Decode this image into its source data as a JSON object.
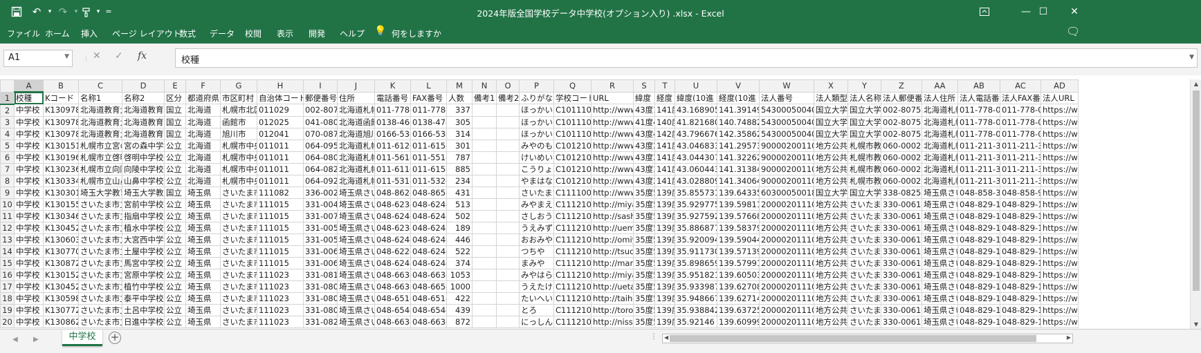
{
  "window": {
    "title": "2024年版全国学校データ中学校(オプション入り) .xlsx  -  Excel"
  },
  "quick_access": {
    "customize": "="
  },
  "ribbon": {
    "tabs": [
      "ファイル",
      "ホーム",
      "挿入",
      "ページ レイアウト",
      "数式",
      "データ",
      "校閲",
      "表示",
      "開発",
      "ヘルプ"
    ],
    "tell_me": "何をしますか"
  },
  "formula_bar": {
    "name_box": "A1",
    "cancel": "✕",
    "enter": "✓",
    "fx": "fx",
    "value": "校種"
  },
  "columns": [
    "A",
    "B",
    "C",
    "D",
    "E",
    "F",
    "G",
    "H",
    "I",
    "J",
    "K",
    "L",
    "M",
    "N",
    "O",
    "P",
    "Q",
    "R",
    "S",
    "T",
    "U",
    "V",
    "W",
    "X",
    "Y",
    "Z",
    "AA",
    "AB",
    "AC",
    "AD"
  ],
  "rows": [
    [
      "1",
      "校種",
      "Kコード",
      "名称1",
      "名称2",
      "区分",
      "都道府県",
      "市区町村",
      "自治体コード",
      "郵便番号",
      "住所",
      "電話番号",
      "FAX番号",
      "人数",
      "備考1",
      "備考2",
      "ふりがな",
      "学校コード",
      "URL",
      "緯度",
      "経度",
      "緯度(10進",
      "経度(10進",
      "法人番号",
      "法人類型",
      "法人名称",
      "法人郵便番",
      "法人住所",
      "法人電話番",
      "法人FAX番",
      "法人URL"
    ],
    [
      "2",
      "中学校",
      "K1309786",
      "北海道教育大",
      "北海道教育大",
      "国立",
      "北海道",
      "札幌市北区",
      "011029",
      "002-8075",
      "北海道札幌",
      "011-778-0",
      "011-778-0",
      "337",
      "",
      "",
      "ほっかいど",
      "C1011100",
      "http://www",
      "43度1",
      "141度",
      "43.16890597",
      "141.3914963",
      "5430005004015",
      "国立大学",
      "国立大学",
      "002-8075",
      "北海道札幌",
      "011-778-0",
      "011-778-06",
      "https://www"
    ],
    [
      "3",
      "中学校",
      "K1309784",
      "北海道教育大",
      "北海道教育大",
      "国立",
      "北海道",
      "函館市",
      "012025",
      "041-0806",
      "北海道函館",
      "0138-46-2",
      "0138-47-0",
      "305",
      "",
      "",
      "ほっかいど",
      "C1011100",
      "http://www",
      "41度4",
      "140度",
      "41.82168047",
      "140.7488202",
      "5430005004015",
      "国立大学",
      "国立大学",
      "002-8075",
      "北海道札幌",
      "011-778-0",
      "011-778-06",
      "https://www"
    ],
    [
      "4",
      "中学校",
      "K1309785",
      "北海道教育大",
      "北海道教育大",
      "国立",
      "北海道",
      "旭川市",
      "012041",
      "070-0874",
      "北海道旭川",
      "0166-53-2",
      "0166-53-2",
      "314",
      "",
      "",
      "ほっかいど",
      "C1011100",
      "http://www",
      "43度4",
      "142度",
      "43.7966765",
      "142.3586282",
      "5430005004015",
      "国立大学",
      "国立大学",
      "002-8075",
      "北海道札幌",
      "011-778-0",
      "011-778-06",
      "https://www"
    ],
    [
      "5",
      "中学校",
      "K1301519",
      "札幌市立宮の",
      "宮の森中学校",
      "公立",
      "北海道",
      "札幌市中央",
      "011011",
      "064-0951",
      "北海道札幌",
      "011-612-1",
      "011-615-6",
      "301",
      "",
      "",
      "みやのもり",
      "C1012101",
      "http://www",
      "43度2",
      "141度",
      "43.04683398",
      "141.2957348",
      "9000020011002",
      "地方公共",
      "札幌市教",
      "060-0002",
      "北海道札幌",
      "011-211-3",
      "011-211-38",
      "https://www"
    ],
    [
      "6",
      "中学校",
      "K1301961",
      "札幌市立啓明",
      "啓明中学校",
      "公立",
      "北海道",
      "札幌市中央",
      "011011",
      "064-0809",
      "北海道札幌",
      "011-561-4",
      "011-551-4",
      "787",
      "",
      "",
      "けいめい",
      "C1012101",
      "http://www",
      "43度2",
      "141度",
      "43.04430714",
      "141.322622",
      "9000020011002",
      "地方公共",
      "札幌市教",
      "060-0002",
      "北海道札幌",
      "011-211-3",
      "011-211-38",
      "https://www"
    ],
    [
      "7",
      "中学校",
      "K1302369",
      "札幌市立向陵",
      "向陵中学校",
      "公立",
      "北海道",
      "札幌市中央",
      "011011",
      "064-0824",
      "北海道札幌",
      "011-611-4",
      "011-615-6",
      "885",
      "",
      "",
      "こうりょう",
      "C1012101",
      "http://www",
      "43度3",
      "141度",
      "43.0604439",
      "141.3138435",
      "9000020011002",
      "地方公共",
      "札幌市教",
      "060-0002",
      "北海道札幌",
      "011-211-3",
      "011-211-38",
      "https://www"
    ],
    [
      "8",
      "中学校",
      "K1303348",
      "札幌市立山鼻",
      "山鼻中学校",
      "公立",
      "北海道",
      "札幌市中央",
      "011011",
      "064-0923",
      "北海道札幌",
      "011-531-9",
      "011-532-6",
      "234",
      "",
      "",
      "やまはな",
      "C1012101",
      "http://www",
      "43度2",
      "141度",
      "43.02880945",
      "141.3406483",
      "9000020011002",
      "地方公共",
      "札幌市教",
      "060-0002",
      "北海道札幌",
      "011-211-3",
      "011-211-38",
      "https://www"
    ],
    [
      "9",
      "中学校",
      "K1303018",
      "埼玉大学教育",
      "埼玉大学教育",
      "国立",
      "埼玉県",
      "さいたま市",
      "111082",
      "336-0021",
      "埼玉県さい",
      "048-862-2",
      "048-865-6",
      "431",
      "",
      "",
      "さいたまだ",
      "C1111000",
      "http://www",
      "35度5",
      "139度",
      "35.85573187",
      "139.6433548",
      "6030005001803",
      "国立大学",
      "国立大学",
      "338-0825",
      "埼玉県さい",
      "048-858-3",
      "048-858-90",
      "https://www"
    ],
    [
      "10",
      "中学校",
      "K1301557",
      "さいたま市立",
      "宮前中学校",
      "公立",
      "埼玉県",
      "さいたま市",
      "111015",
      "331-0046",
      "埼玉県さい",
      "048-623-7",
      "048-624-2",
      "513",
      "",
      "",
      "みやまえ",
      "C1112101",
      "http://miya",
      "35度5",
      "139度",
      "35.92977503",
      "139.598118",
      "2000020111007",
      "地方公共",
      "さいたま市",
      "330-0061",
      "埼玉県さい",
      "048-829-1",
      "048-829-19",
      "https://www"
    ],
    [
      "11",
      "中学校",
      "K1303463",
      "さいたま市立",
      "指扇中学校",
      "公立",
      "埼玉県",
      "さいたま市",
      "111015",
      "331-0078",
      "埼玉県さい",
      "048-624-6",
      "048-624-2",
      "502",
      "",
      "",
      "さしおうぎ",
      "C1112101",
      "http://sash",
      "35度5",
      "139度",
      "35.92759258",
      "139.5766894",
      "2000020111007",
      "地方公共",
      "さいたま市",
      "330-0061",
      "埼玉県さい",
      "048-829-1",
      "048-829-19",
      "https://www"
    ],
    [
      "12",
      "中学校",
      "K1304520",
      "さいたま市立",
      "植水中学校",
      "公立",
      "埼玉県",
      "さいたま市",
      "111015",
      "331-0056",
      "埼玉県さい",
      "048-623-2",
      "048-624-2",
      "189",
      "",
      "",
      "うえみず",
      "C1112101",
      "http://uemi",
      "35度5",
      "139度",
      "35.88687745",
      "139.5837937",
      "2000020111007",
      "地方公共",
      "さいたま市",
      "330-0061",
      "埼玉県さい",
      "048-829-1",
      "048-829-19",
      "https://www"
    ],
    [
      "13",
      "中学校",
      "K1306036",
      "さいたま市立",
      "大宮西中学校",
      "公立",
      "埼玉県",
      "さいたま市",
      "111015",
      "331-0052",
      "埼玉県さい",
      "048-624-4",
      "048-624-2",
      "446",
      "",
      "",
      "おおみやに",
      "C1112101",
      "http://omiy",
      "35度5",
      "139度",
      "35.92009449",
      "139.5904451",
      "2000020111007",
      "地方公共",
      "さいたま市",
      "330-0061",
      "埼玉県さい",
      "048-829-1",
      "048-829-19",
      "https://www"
    ],
    [
      "14",
      "中学校",
      "K1307705",
      "さいたま市立",
      "土屋中学校",
      "公立",
      "埼玉県",
      "さいたま市",
      "111015",
      "331-0062",
      "埼玉県さい",
      "048-622-4",
      "048-624-2",
      "522",
      "",
      "",
      "つちや",
      "C1112101",
      "http://tsuc",
      "35度5",
      "139度",
      "35.91173003",
      "139.5713978",
      "2000020111007",
      "地方公共",
      "さいたま市",
      "330-0061",
      "埼玉県さい",
      "048-829-1",
      "048-829-19",
      "https://www"
    ],
    [
      "15",
      "中学校",
      "K1308725",
      "さいたま市立",
      "馬宮中学校",
      "公立",
      "埼玉県",
      "さいたま市",
      "111015",
      "331-0065",
      "埼玉県さい",
      "048-624-0",
      "048-624-2",
      "374",
      "",
      "",
      "まみや",
      "C1112101",
      "http://mam",
      "35度5",
      "139度",
      "35.89865983",
      "139.5799167",
      "2000020111007",
      "地方公共",
      "さいたま市",
      "330-0061",
      "埼玉県さい",
      "048-829-1",
      "048-829-19",
      "https://www"
    ],
    [
      "16",
      "中学校",
      "K1301526",
      "さいたま市立",
      "宮原中学校",
      "公立",
      "埼玉県",
      "さいたま市",
      "111023",
      "331-0812",
      "埼玉県さい",
      "048-663-0",
      "048-663-9",
      "1053",
      "",
      "",
      "みやはら",
      "C1112102",
      "http://miya",
      "35度5",
      "139度",
      "35.95182199",
      "139.6050309",
      "2000020111007",
      "地方公共",
      "さいたま市",
      "330-0061",
      "埼玉県さい",
      "048-829-1",
      "048-829-19",
      "https://www"
    ],
    [
      "17",
      "中学校",
      "K1304521",
      "さいたま市立",
      "植竹中学校",
      "公立",
      "埼玉県",
      "さいたま市",
      "111023",
      "331-0804",
      "埼玉県さい",
      "048-663-2",
      "048-665-6",
      "1000",
      "",
      "",
      "うえたけ",
      "C1112102",
      "http://ueta",
      "35度5",
      "139度",
      "35.93398763",
      "139.6270836",
      "2000020111007",
      "地方公共",
      "さいたま市",
      "330-0061",
      "埼玉県さい",
      "048-829-1",
      "048-829-19",
      "https://www"
    ],
    [
      "18",
      "中学校",
      "K1305984",
      "さいたま市立",
      "泰平中学校",
      "公立",
      "埼玉県",
      "さいたま市",
      "111023",
      "331-0802",
      "埼玉県さい",
      "048-651-4",
      "048-651-4",
      "422",
      "",
      "",
      "たいへい",
      "C1112102",
      "http://taihe",
      "35度5",
      "139度",
      "35.94866725",
      "139.6271477",
      "2000020111007",
      "地方公共",
      "さいたま市",
      "330-0061",
      "埼玉県さい",
      "048-829-1",
      "048-829-19",
      "https://www"
    ],
    [
      "19",
      "中学校",
      "K1307729",
      "さいたま市立",
      "土呂中学校",
      "公立",
      "埼玉県",
      "さいたま市",
      "111023",
      "331-0803",
      "埼玉県さい",
      "048-654-5",
      "048-654-5",
      "439",
      "",
      "",
      "とろ",
      "C1112102",
      "http://toro-",
      "35度5",
      "139度",
      "35.93884208",
      "139.6372516",
      "2000020111007",
      "地方公共",
      "さいたま市",
      "330-0061",
      "埼玉県さい",
      "048-829-1",
      "048-829-19",
      "https://www"
    ],
    [
      "20",
      "中学校",
      "K1308620",
      "さいたま市立",
      "日進中学校",
      "公立",
      "埼玉県",
      "さいたま市",
      "111023",
      "331-0825",
      "埼玉県さい",
      "048-663-1",
      "048-663-0",
      "872",
      "",
      "",
      "にっしん",
      "C1112102",
      "http://nissh",
      "35度5",
      "139度",
      "35.92146",
      "139.6099972",
      "2000020111007",
      "地方公共",
      "さいたま市",
      "330-0061",
      "埼玉県さい",
      "048-829-1",
      "048-829-19",
      "https://www"
    ]
  ],
  "sheet_bar": {
    "active_sheet": "中学校",
    "add": "+"
  },
  "colors": {
    "accent": "#217346"
  }
}
